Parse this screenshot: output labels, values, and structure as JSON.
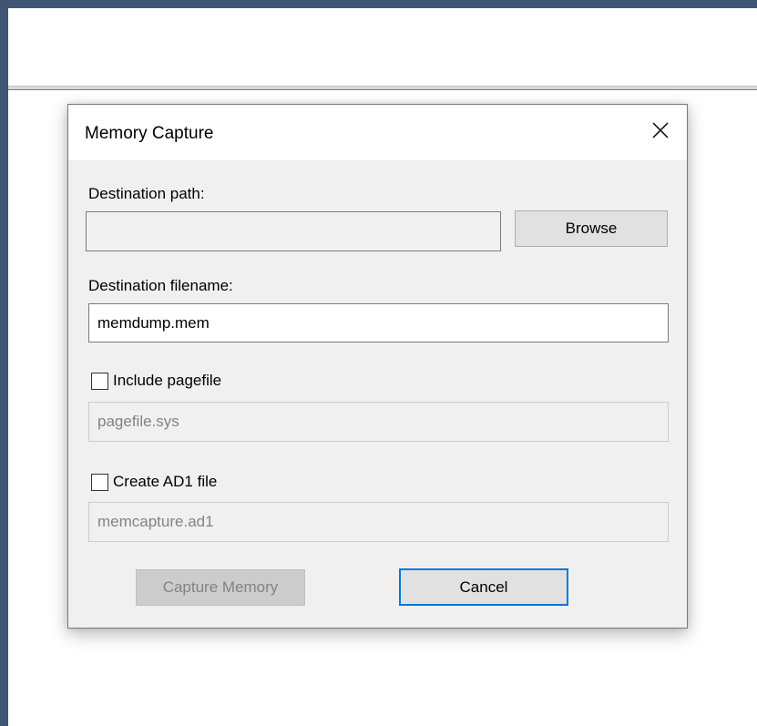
{
  "dialog": {
    "title": "Memory Capture",
    "close_icon": "close-icon",
    "destination_path": {
      "label": "Destination path:",
      "value": "",
      "browse_label": "Browse"
    },
    "destination_filename": {
      "label": "Destination filename:",
      "value": "memdump.mem"
    },
    "include_pagefile": {
      "label": "Include pagefile",
      "checked": false,
      "value": "pagefile.sys"
    },
    "create_ad1": {
      "label": "Create AD1 file",
      "checked": false,
      "value": "memcapture.ad1"
    },
    "buttons": {
      "capture_label": "Capture Memory",
      "cancel_label": "Cancel"
    }
  },
  "colors": {
    "desktop_background": "#3f5673",
    "dialog_background": "#f0f0f0",
    "focus_accent": "#0078d7",
    "disabled_text": "#838383"
  }
}
